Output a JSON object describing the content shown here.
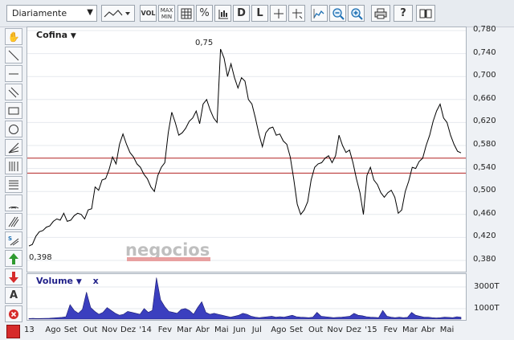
{
  "toolbar": {
    "period": "Diariamente",
    "vol_label": "VOL",
    "maxmin_label_1": "MAX",
    "maxmin_label_2": "MIN",
    "percent_label": "%",
    "d_label": "D",
    "l_label": "L",
    "help_label": "?"
  },
  "chart": {
    "name": "Cofina",
    "watermark": "negocios",
    "max_label": "0,75",
    "min_label": "0,398",
    "price_ticks": [
      "0,780",
      "0,740",
      "0,700",
      "0,660",
      "0,620",
      "0,580",
      "0,540",
      "0,500",
      "0,460",
      "0,420",
      "0,380"
    ],
    "months": [
      "13",
      "Ago",
      "Set",
      "Out",
      "Nov",
      "Dez",
      "'14",
      "Fev",
      "Mar",
      "Abr",
      "Mai",
      "Jun",
      "Jul",
      "Ago",
      "Set",
      "Out",
      "Nov",
      "Dez",
      "'15",
      "Fev",
      "Mar",
      "Abr",
      "Mai"
    ],
    "resistance_line": 0.558,
    "support_line": 0.532,
    "line_color": "#000000",
    "hline_color": "#b22222"
  },
  "volume": {
    "name": "Volume",
    "close_label": "x",
    "ticks": [
      "3000T",
      "1000T"
    ],
    "fill_color": "#3b3fbf"
  },
  "chart_data": {
    "type": "line",
    "series": [
      {
        "name": "Cofina",
        "values": [
          0.405,
          0.41,
          0.42,
          0.43,
          0.43,
          0.44,
          0.44,
          0.45,
          0.45,
          0.45,
          0.46,
          0.45,
          0.45,
          0.46,
          0.46,
          0.46,
          0.45,
          0.47,
          0.47,
          0.51,
          0.5,
          0.52,
          0.52,
          0.54,
          0.56,
          0.55,
          0.58,
          0.6,
          0.58,
          0.57,
          0.56,
          0.55,
          0.54,
          0.53,
          0.52,
          0.51,
          0.5,
          0.53,
          0.54,
          0.55,
          0.6,
          0.64,
          0.62,
          0.6,
          0.6,
          0.61,
          0.62,
          0.63,
          0.64,
          0.62,
          0.65,
          0.66,
          0.64,
          0.63,
          0.62,
          0.75,
          0.73,
          0.7,
          0.72,
          0.7,
          0.68,
          0.7,
          0.69,
          0.66,
          0.65,
          0.63,
          0.6,
          0.58,
          0.6,
          0.61,
          0.61,
          0.6,
          0.6,
          0.59,
          0.58,
          0.56,
          0.52,
          0.48,
          0.46,
          0.47,
          0.48,
          0.52,
          0.54,
          0.55,
          0.55,
          0.56,
          0.56,
          0.55,
          0.56,
          0.6,
          0.58,
          0.57,
          0.57,
          0.55,
          0.52,
          0.5,
          0.46,
          0.53,
          0.54,
          0.52,
          0.51,
          0.5,
          0.49,
          0.5,
          0.5,
          0.49,
          0.46,
          0.47,
          0.5,
          0.52,
          0.54,
          0.54,
          0.55,
          0.56,
          0.58,
          0.6,
          0.62,
          0.64,
          0.65,
          0.63,
          0.62,
          0.6,
          0.58,
          0.57,
          0.565
        ]
      }
    ],
    "ylim": [
      0.38,
      0.78
    ],
    "volume_values": [
      60,
      80,
      60,
      70,
      80,
      90,
      120,
      150,
      180,
      240,
      1500,
      900,
      600,
      1000,
      2800,
      1200,
      800,
      500,
      700,
      1200,
      900,
      600,
      400,
      500,
      800,
      700,
      600,
      500,
      1100,
      700,
      900,
      4300,
      2000,
      1300,
      800,
      700,
      600,
      1000,
      1100,
      900,
      500,
      1200,
      1800,
      700,
      500,
      600,
      500,
      400,
      300,
      200,
      300,
      400,
      600,
      500,
      300,
      200,
      150,
      200,
      250,
      300,
      200,
      250,
      200,
      300,
      400,
      250,
      200,
      180,
      150,
      200,
      700,
      300,
      250,
      200,
      150,
      180,
      200,
      250,
      300,
      600,
      400,
      350,
      250,
      200,
      180,
      150,
      900,
      300,
      200,
      150,
      200,
      150,
      180,
      700,
      400,
      300,
      200,
      200,
      150,
      120,
      150,
      200,
      180,
      150,
      250,
      200
    ]
  }
}
